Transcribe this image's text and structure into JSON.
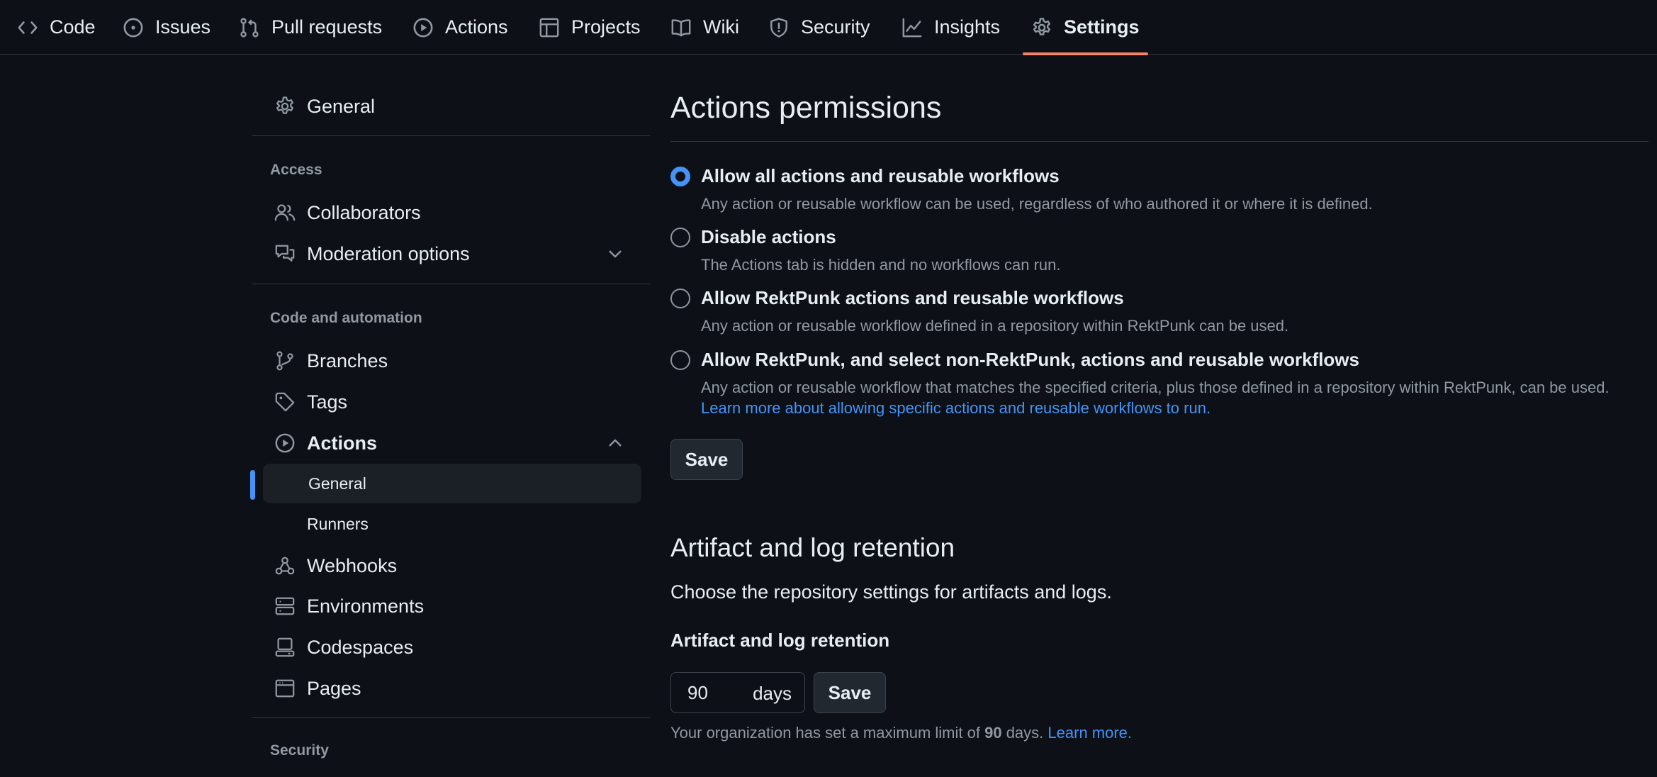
{
  "topnav": {
    "tabs": [
      {
        "label": "Code",
        "icon": "code-icon"
      },
      {
        "label": "Issues",
        "icon": "issue-opened-icon"
      },
      {
        "label": "Pull requests",
        "icon": "git-pull-request-icon"
      },
      {
        "label": "Actions",
        "icon": "play-icon"
      },
      {
        "label": "Projects",
        "icon": "table-icon"
      },
      {
        "label": "Wiki",
        "icon": "book-icon"
      },
      {
        "label": "Security",
        "icon": "shield-icon"
      },
      {
        "label": "Insights",
        "icon": "graph-icon"
      },
      {
        "label": "Settings",
        "icon": "gear-icon",
        "active": true
      }
    ],
    "active_tab_indicator_color": "#f78166"
  },
  "sidebar": {
    "general": "General",
    "access_heading": "Access",
    "collaborators": "Collaborators",
    "moderation": "Moderation options",
    "code_heading": "Code and automation",
    "branches": "Branches",
    "tags": "Tags",
    "actions": "Actions",
    "actions_general": "General",
    "actions_runners": "Runners",
    "webhooks": "Webhooks",
    "environments": "Environments",
    "codespaces": "Codespaces",
    "pages": "Pages",
    "security_heading": "Security"
  },
  "main": {
    "permissions_title": "Actions permissions",
    "options": [
      {
        "title": "Allow all actions and reusable workflows",
        "desc": "Any action or reusable workflow can be used, regardless of who authored it or where it is defined.",
        "checked": true
      },
      {
        "title": "Disable actions",
        "desc": "The Actions tab is hidden and no workflows can run.",
        "checked": false
      },
      {
        "title": "Allow RektPunk actions and reusable workflows",
        "desc": "Any action or reusable workflow defined in a repository within RektPunk can be used.",
        "checked": false
      },
      {
        "title": "Allow RektPunk, and select non-RektPunk, actions and reusable workflows",
        "desc": "Any action or reusable workflow that matches the specified criteria, plus those defined in a repository within RektPunk, can be used.",
        "link": "Learn more about allowing specific actions and reusable workflows to run.",
        "checked": false
      }
    ],
    "save_label": "Save",
    "retention_title": "Artifact and log retention",
    "retention_desc": "Choose the repository settings for artifacts and logs.",
    "retention_label": "Artifact and log retention",
    "retention_value": "90",
    "retention_unit": "days",
    "retention_save_label": "Save",
    "note_prefix": "Your organization has set a maximum limit of",
    "note_value": "90",
    "note_suffix": "days.",
    "note_link": "Learn more."
  },
  "colors": {
    "background": "#0d1117",
    "accent": "#4493f8",
    "muted": "#9198a1",
    "border": "#30363d"
  }
}
